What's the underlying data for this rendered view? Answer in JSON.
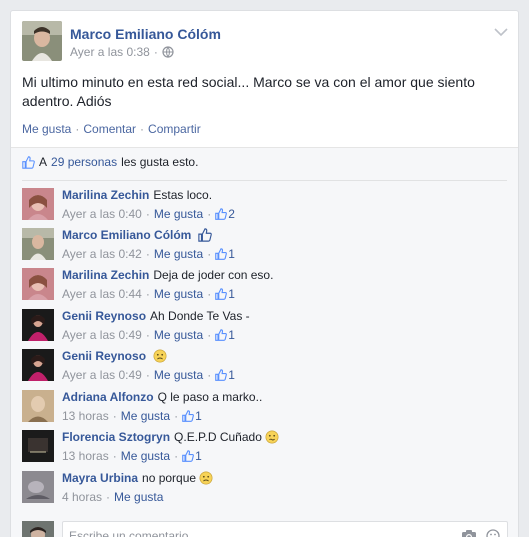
{
  "post": {
    "author": "Marco Emiliano Cólóm",
    "time": "Ayer a las 0:38",
    "audience_separator": "·",
    "text": "Mi ultimo minuto en esta red social... Marco se va con el amor que siento adentro. Adiós",
    "actions": [
      "Me gusta",
      "Comentar",
      "Compartir"
    ],
    "action_separator": "·"
  },
  "likes": {
    "prefix": "A",
    "people": "29 personas",
    "suffix": "les gusta esto."
  },
  "comments": [
    {
      "name": "Marilina Zechin",
      "text": "Estas loco.",
      "time": "Ayer a las 0:40",
      "like": "Me gusta",
      "likes": "2",
      "emoji": "",
      "avatar": "pink"
    },
    {
      "name": "Marco Emiliano Cólóm",
      "text": "",
      "time": "Ayer a las 0:42",
      "like": "Me gusta",
      "likes": "1",
      "emoji": "thumbs-up",
      "avatar": "marco"
    },
    {
      "name": "Marilina Zechin",
      "text": "Deja de joder con eso.",
      "time": "Ayer a las 0:44",
      "like": "Me gusta",
      "likes": "1",
      "emoji": "",
      "avatar": "pink"
    },
    {
      "name": "Genii Reynoso",
      "text": "Ah Donde Te Vas -",
      "time": "Ayer a las 0:49",
      "like": "Me gusta",
      "likes": "1",
      "emoji": "",
      "avatar": "magenta"
    },
    {
      "name": "Genii Reynoso",
      "text": "",
      "time": "Ayer a las 0:49",
      "like": "Me gusta",
      "likes": "1",
      "emoji": "frown",
      "avatar": "magenta"
    },
    {
      "name": "Adriana Alfonzo",
      "text": "Q le paso a marko..",
      "time": "13 horas",
      "like": "Me gusta",
      "likes": "1",
      "emoji": "",
      "avatar": "beige"
    },
    {
      "name": "Florencia Sztogryn",
      "text": "Q.E.P.D Cuñado",
      "time": "13 horas",
      "like": "Me gusta",
      "likes": "1",
      "emoji": "confused",
      "avatar": "dark"
    },
    {
      "name": "Mayra Urbina",
      "text": "no porque",
      "time": "4 horas",
      "like": "Me gusta",
      "likes": "",
      "emoji": "frown",
      "avatar": "gray"
    }
  ],
  "composer": {
    "placeholder": "Escribe un comentario..."
  },
  "colors": {
    "link": "#365899",
    "muted": "#90949c",
    "ufi_bg": "#f6f7f9"
  }
}
